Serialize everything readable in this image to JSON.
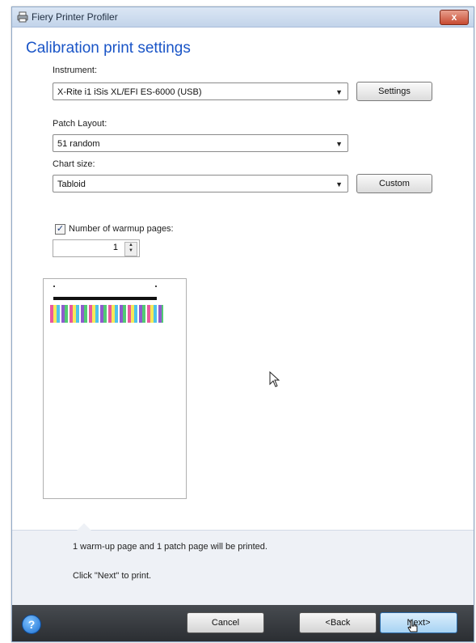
{
  "window": {
    "title": "Fiery Printer Profiler",
    "close_label": "x"
  },
  "page": {
    "heading": "Calibration print settings"
  },
  "instrument": {
    "label": "Instrument:",
    "value": "X-Rite i1 iSis XL/EFI ES-6000 (USB)",
    "settings_button": "Settings"
  },
  "patch_layout": {
    "label": "Patch Layout:",
    "value": "51 random"
  },
  "chart_size": {
    "label": "Chart size:",
    "value": "Tabloid",
    "custom_button": "Custom"
  },
  "warmup": {
    "checkbox_label": "Number of warmup pages:",
    "checked": true,
    "count": "1"
  },
  "info": {
    "line1": "1 warm-up page and 1 patch page will be printed.",
    "line2": "Click \"Next\" to print."
  },
  "footer": {
    "help_label": "?",
    "cancel": "Cancel",
    "back": "<Back",
    "next": "Next>"
  },
  "icons": {
    "app": "printer-icon",
    "help": "help-icon",
    "cursor": "mouse-pointer-icon",
    "hand": "hand-pointer-icon"
  },
  "colors": {
    "heading": "#1a55c7",
    "footer_bg": "#2b2e32",
    "info_bg": "#eef1f6"
  }
}
